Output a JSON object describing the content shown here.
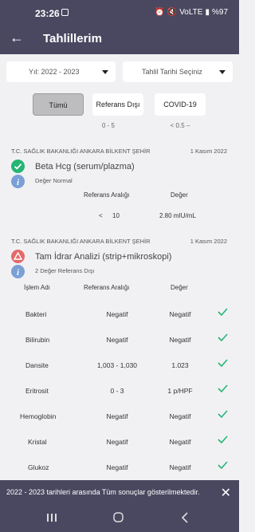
{
  "status": {
    "time": "23:26",
    "signal_text": "VoLTE",
    "battery": "%97"
  },
  "appbar": {
    "title": "Tahlillerim"
  },
  "filters": {
    "year_value": "Yıl: 2022 - 2023",
    "date_placeholder": "Tahlil Tarihi Seçiniz",
    "tabs": [
      "Tümü",
      "Referans Dışı",
      "COVID-19"
    ],
    "ranges": [
      "0 - 5",
      "< 0.5 –"
    ]
  },
  "card1": {
    "institution": "T.C. SAĞLIK BAKANLIĞI ANKARA BİLKENT ŞEHİR",
    "date": "1 Kasım 2022",
    "test": "Beta Hcg (serum/plazma)",
    "note": "Değer Normal",
    "ref_header": "Referans Aralığı",
    "val_header": "Değer",
    "ref_op": "<",
    "ref_val": "10",
    "value": "2.80 mIU/mL"
  },
  "card2": {
    "institution": "T.C. SAĞLIK BAKANLIĞI ANKARA BİLKENT ŞEHİR",
    "date": "1 Kasım 2022",
    "test": "Tam İdrar Analizi (strip+mikroskopi)",
    "note": "2 Değer Referans Dışı",
    "headers": [
      "İşlem Adı",
      "Referans Aralığı",
      "Değer"
    ],
    "rows": [
      {
        "name": "Bakteri",
        "ref": "Negatif",
        "value": "Negatif"
      },
      {
        "name": "Bilirubin",
        "ref": "Negatif",
        "value": "Negatif"
      },
      {
        "name": "Dansite",
        "ref": "1,003 - 1,030",
        "value": "1.023"
      },
      {
        "name": "Eritrosit",
        "ref": "0 - 3",
        "value": "1 p/HPF"
      },
      {
        "name": "Hemoglobin",
        "ref": "Negatif",
        "value": "Negatif"
      },
      {
        "name": "Kristal",
        "ref": "Negatif",
        "value": "Negatif"
      },
      {
        "name": "Glukoz",
        "ref": "Negatif",
        "value": "Negatif"
      }
    ]
  },
  "toast": {
    "message": "2022 - 2023 tarihleri arasında Tüm sonuçlar gösterilmektedir."
  },
  "colors": {
    "primary": "#4a4860",
    "ok_green": "#26b573",
    "warn_red": "#e46a6a",
    "info_blue": "#7ba0d6"
  }
}
